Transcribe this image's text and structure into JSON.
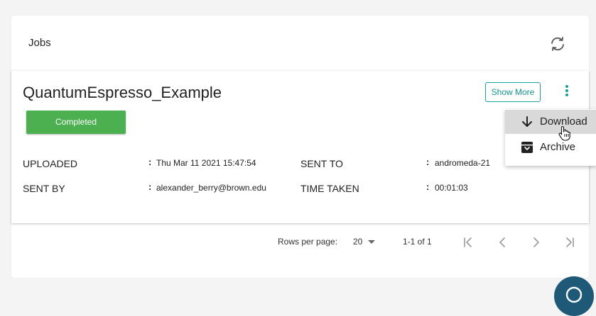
{
  "panel": {
    "title": "Jobs",
    "refresh_icon": "refresh-icon"
  },
  "job": {
    "title": "QuantumEspresso_Example",
    "status": "Completed",
    "status_color": "#4caf50",
    "show_more_label": "Show More",
    "menu_icon": "more-vertical-icon",
    "fields": {
      "uploaded_label": "UPLOADED",
      "uploaded_value": "Thu Mar 11 2021 15:47:54",
      "sent_by_label": "SENT BY",
      "sent_by_value": "alexander_berry@brown.edu",
      "sent_to_label": "SENT TO",
      "sent_to_value": "andromeda-21",
      "time_taken_label": "TIME TAKEN",
      "time_taken_value": "00:01:03"
    },
    "colon": ":"
  },
  "menu": {
    "items": [
      {
        "label": "Download",
        "icon": "download-icon"
      },
      {
        "label": "Archive",
        "icon": "archive-icon"
      }
    ]
  },
  "pagination": {
    "rows_per_page_label": "Rows per page:",
    "rows_per_page_value": "20",
    "range": "1-1 of 1",
    "first_icon": "first-page-icon",
    "prev_icon": "chevron-left-icon",
    "next_icon": "chevron-right-icon",
    "last_icon": "last-page-icon"
  },
  "accent_color": "#15a196",
  "chat_icon": "chat-icon"
}
